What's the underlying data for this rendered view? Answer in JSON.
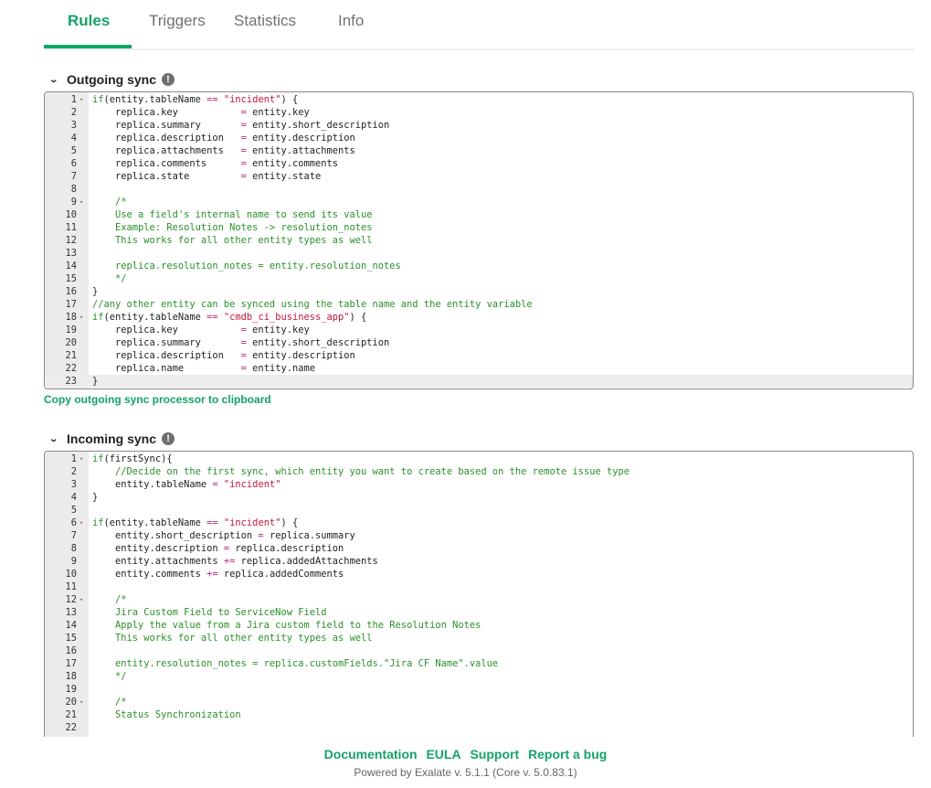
{
  "tabs": [
    {
      "label": "Rules",
      "active": true
    },
    {
      "label": "Triggers",
      "active": false
    },
    {
      "label": "Statistics",
      "active": false
    },
    {
      "label": "Info",
      "active": false
    }
  ],
  "outgoing": {
    "title": "Outgoing sync",
    "info_icon": "exclamation-circle-icon",
    "copy_label": "Copy outgoing sync processor to clipboard",
    "active_line": 23,
    "lines": [
      {
        "n": "1",
        "fold": true,
        "tokens": [
          [
            "kw",
            "if"
          ],
          [
            "id",
            "(entity.tableName "
          ],
          [
            "op",
            "=="
          ],
          [
            "id",
            " "
          ],
          [
            "str",
            "\"incident\""
          ],
          [
            "id",
            ") {"
          ]
        ]
      },
      {
        "n": "2",
        "tokens": [
          [
            "id",
            "    replica.key           "
          ],
          [
            "op",
            "="
          ],
          [
            "id",
            " entity.key"
          ]
        ]
      },
      {
        "n": "3",
        "tokens": [
          [
            "id",
            "    replica.summary       "
          ],
          [
            "op",
            "="
          ],
          [
            "id",
            " entity.short_description"
          ]
        ]
      },
      {
        "n": "4",
        "tokens": [
          [
            "id",
            "    replica.description   "
          ],
          [
            "op",
            "="
          ],
          [
            "id",
            " entity.description"
          ]
        ]
      },
      {
        "n": "5",
        "tokens": [
          [
            "id",
            "    replica.attachments   "
          ],
          [
            "op",
            "="
          ],
          [
            "id",
            " entity.attachments"
          ]
        ]
      },
      {
        "n": "6",
        "tokens": [
          [
            "id",
            "    replica.comments      "
          ],
          [
            "op",
            "="
          ],
          [
            "id",
            " entity.comments"
          ]
        ]
      },
      {
        "n": "7",
        "tokens": [
          [
            "id",
            "    replica.state         "
          ],
          [
            "op",
            "="
          ],
          [
            "id",
            " entity.state"
          ]
        ]
      },
      {
        "n": "8",
        "tokens": []
      },
      {
        "n": "9",
        "fold": true,
        "tokens": [
          [
            "cm",
            "    /*"
          ]
        ]
      },
      {
        "n": "10",
        "tokens": [
          [
            "cm",
            "    Use a field's internal name to send its value"
          ]
        ]
      },
      {
        "n": "11",
        "tokens": [
          [
            "cm",
            "    Example: Resolution Notes -> resolution_notes"
          ]
        ]
      },
      {
        "n": "12",
        "tokens": [
          [
            "cm",
            "    This works for all other entity types as well"
          ]
        ]
      },
      {
        "n": "13",
        "tokens": []
      },
      {
        "n": "14",
        "tokens": [
          [
            "cm",
            "    replica.resolution_notes = entity.resolution_notes"
          ]
        ]
      },
      {
        "n": "15",
        "tokens": [
          [
            "cm",
            "    */"
          ]
        ]
      },
      {
        "n": "16",
        "tokens": [
          [
            "id",
            "}"
          ]
        ]
      },
      {
        "n": "17",
        "tokens": [
          [
            "cm",
            "//any other entity can be synced using the table name and the entity variable"
          ]
        ]
      },
      {
        "n": "18",
        "fold": true,
        "tokens": [
          [
            "kw",
            "if"
          ],
          [
            "id",
            "(entity.tableName "
          ],
          [
            "op",
            "=="
          ],
          [
            "id",
            " "
          ],
          [
            "str",
            "\"cmdb_ci_business_app\""
          ],
          [
            "id",
            ") {"
          ]
        ]
      },
      {
        "n": "19",
        "tokens": [
          [
            "id",
            "    replica.key           "
          ],
          [
            "op",
            "="
          ],
          [
            "id",
            " entity.key"
          ]
        ]
      },
      {
        "n": "20",
        "tokens": [
          [
            "id",
            "    replica.summary       "
          ],
          [
            "op",
            "="
          ],
          [
            "id",
            " entity.short_description"
          ]
        ]
      },
      {
        "n": "21",
        "tokens": [
          [
            "id",
            "    replica.description   "
          ],
          [
            "op",
            "="
          ],
          [
            "id",
            " entity.description"
          ]
        ]
      },
      {
        "n": "22",
        "tokens": [
          [
            "id",
            "    replica.name          "
          ],
          [
            "op",
            "="
          ],
          [
            "id",
            " entity.name"
          ]
        ]
      },
      {
        "n": "23",
        "tokens": [
          [
            "id",
            "}"
          ]
        ]
      }
    ]
  },
  "incoming": {
    "title": "Incoming sync",
    "info_icon": "exclamation-circle-icon",
    "lines": [
      {
        "n": "1",
        "fold": true,
        "tokens": [
          [
            "kw",
            "if"
          ],
          [
            "id",
            "(firstSync){"
          ]
        ]
      },
      {
        "n": "2",
        "tokens": [
          [
            "cm",
            "    //Decide on the first sync, which entity you want to create based on the remote issue type"
          ]
        ]
      },
      {
        "n": "3",
        "tokens": [
          [
            "id",
            "    entity.tableName "
          ],
          [
            "op",
            "="
          ],
          [
            "id",
            " "
          ],
          [
            "str",
            "\"incident\""
          ]
        ]
      },
      {
        "n": "4",
        "tokens": [
          [
            "id",
            "}"
          ]
        ]
      },
      {
        "n": "5",
        "tokens": []
      },
      {
        "n": "6",
        "fold": true,
        "tokens": [
          [
            "kw",
            "if"
          ],
          [
            "id",
            "(entity.tableName "
          ],
          [
            "op",
            "=="
          ],
          [
            "id",
            " "
          ],
          [
            "str",
            "\"incident\""
          ],
          [
            "id",
            ") {"
          ]
        ]
      },
      {
        "n": "7",
        "tokens": [
          [
            "id",
            "    entity.short_description "
          ],
          [
            "op",
            "="
          ],
          [
            "id",
            " replica.summary"
          ]
        ]
      },
      {
        "n": "8",
        "tokens": [
          [
            "id",
            "    entity.description "
          ],
          [
            "op",
            "="
          ],
          [
            "id",
            " replica.description"
          ]
        ]
      },
      {
        "n": "9",
        "tokens": [
          [
            "id",
            "    entity.attachments "
          ],
          [
            "op",
            "+="
          ],
          [
            "id",
            " replica.addedAttachments"
          ]
        ]
      },
      {
        "n": "10",
        "tokens": [
          [
            "id",
            "    entity.comments "
          ],
          [
            "op",
            "+="
          ],
          [
            "id",
            " replica.addedComments"
          ]
        ]
      },
      {
        "n": "11",
        "tokens": []
      },
      {
        "n": "12",
        "fold": true,
        "tokens": [
          [
            "cm",
            "    /*"
          ]
        ]
      },
      {
        "n": "13",
        "tokens": [
          [
            "cm",
            "    Jira Custom Field to ServiceNow Field"
          ]
        ]
      },
      {
        "n": "14",
        "tokens": [
          [
            "cm",
            "    Apply the value from a Jira custom field to the Resolution Notes"
          ]
        ]
      },
      {
        "n": "15",
        "tokens": [
          [
            "cm",
            "    This works for all other entity types as well"
          ]
        ]
      },
      {
        "n": "16",
        "tokens": []
      },
      {
        "n": "17",
        "tokens": [
          [
            "cm",
            "    entity.resolution_notes = replica.customFields.\"Jira CF Name\".value"
          ]
        ]
      },
      {
        "n": "18",
        "tokens": [
          [
            "cm",
            "    */"
          ]
        ]
      },
      {
        "n": "19",
        "tokens": []
      },
      {
        "n": "20",
        "fold": true,
        "tokens": [
          [
            "cm",
            "    /*"
          ]
        ]
      },
      {
        "n": "21",
        "tokens": [
          [
            "cm",
            "    Status Synchronization"
          ]
        ]
      },
      {
        "n": "22",
        "tokens": []
      }
    ]
  },
  "footer": {
    "links": [
      "Documentation",
      "EULA",
      "Support",
      "Report a bug"
    ],
    "powered_by": "Powered by Exalate v. 5.1.1 (Core v. 5.0.83.1)"
  },
  "colors": {
    "accent": "#14a366",
    "string": "#c3163a",
    "operator": "#b8287e",
    "comment": "#2a8f2a"
  }
}
